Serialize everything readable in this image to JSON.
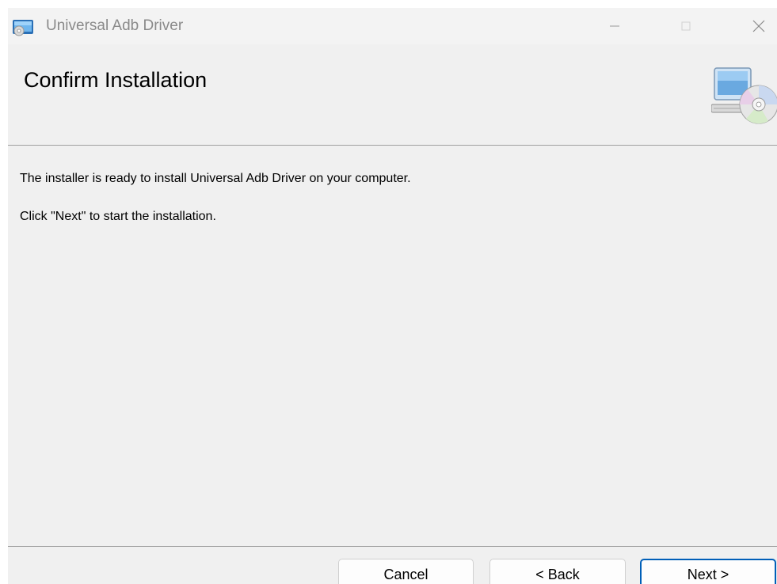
{
  "window": {
    "title": "Universal Adb Driver",
    "icon": "installer-app-icon"
  },
  "header": {
    "title": "Confirm Installation",
    "icon": "computer-cd-icon"
  },
  "content": {
    "line1": "The installer is ready to install Universal Adb Driver on your computer.",
    "line2": "Click \"Next\" to start the installation."
  },
  "buttons": {
    "cancel": "Cancel",
    "back": "< Back",
    "next": "Next >"
  },
  "colors": {
    "background": "#f0f0f0",
    "separator": "#a0a0a0",
    "default_button_border": "#005fb8"
  }
}
